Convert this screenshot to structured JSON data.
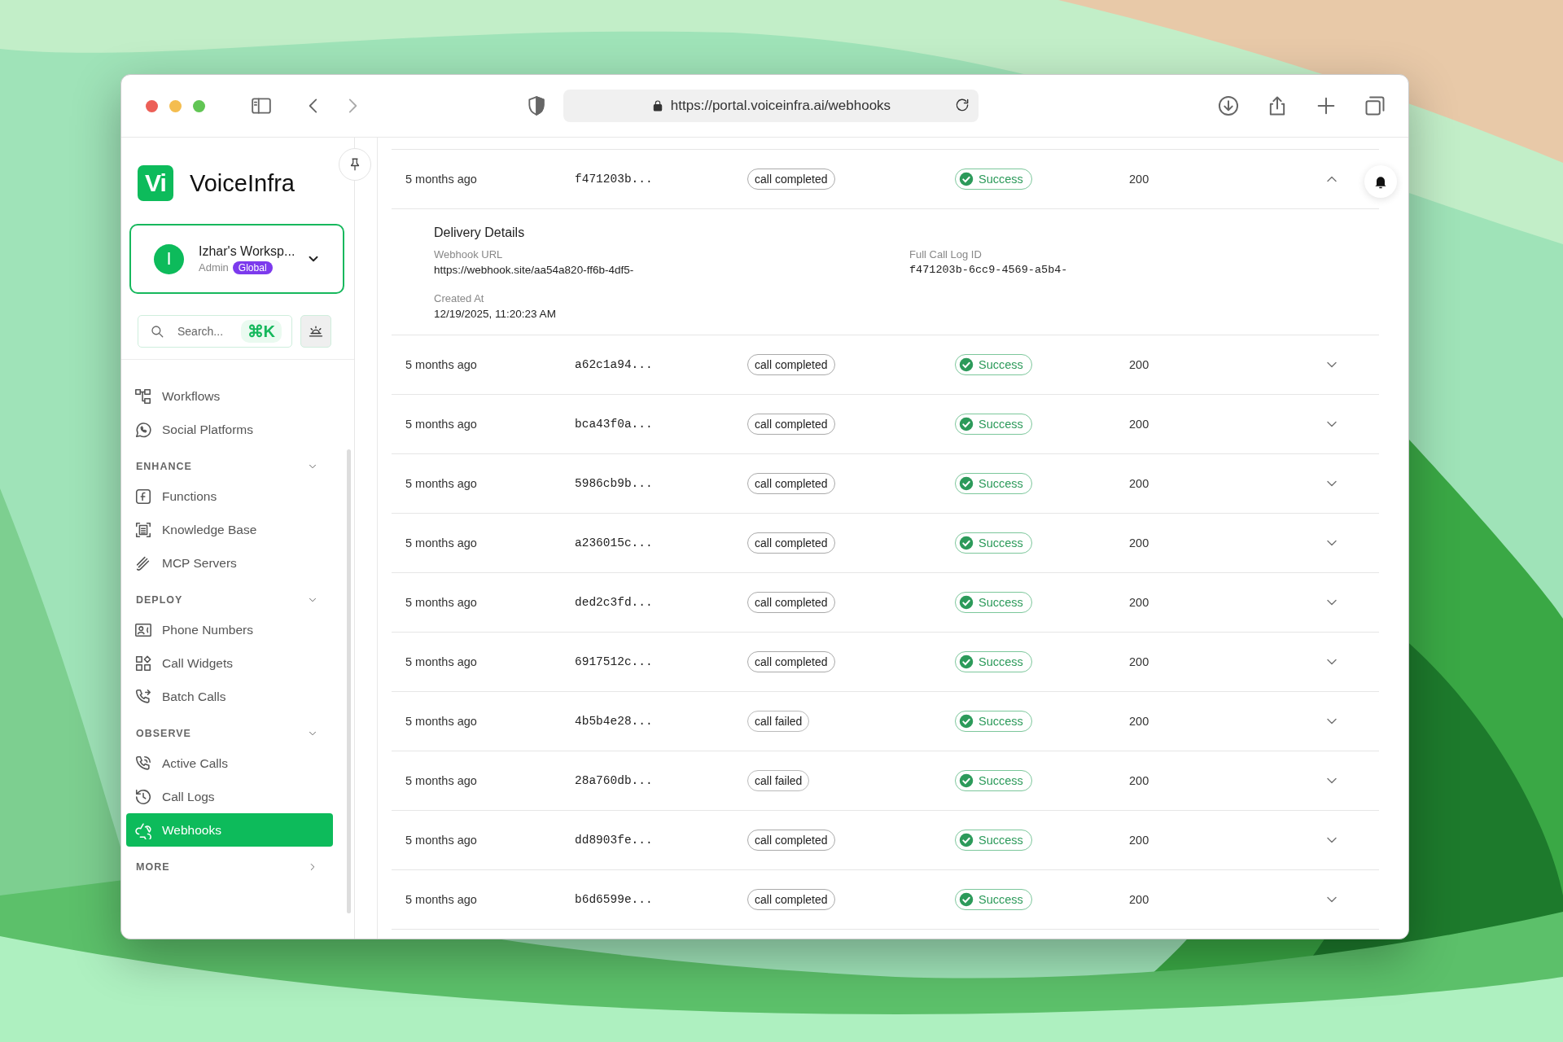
{
  "browser": {
    "url": "https://portal.voiceinfra.ai/webhooks"
  },
  "sidebar": {
    "brand": {
      "mark": "Vi",
      "name": "VoiceInfra"
    },
    "workspace": {
      "initial": "I",
      "name": "Izhar's Worksp...",
      "role": "Admin",
      "badge": "Global"
    },
    "search": {
      "placeholder": "Search...",
      "shortcut": "⌘K"
    },
    "sections": [
      {
        "items": [
          {
            "label": "Workflows",
            "selected": false
          },
          {
            "label": "Social Platforms",
            "selected": false
          }
        ]
      },
      {
        "title": "ENHANCE",
        "expanded": true,
        "items": [
          {
            "label": "Functions",
            "selected": false
          },
          {
            "label": "Knowledge Base",
            "selected": false
          },
          {
            "label": "MCP Servers",
            "selected": false
          }
        ]
      },
      {
        "title": "DEPLOY",
        "expanded": true,
        "items": [
          {
            "label": "Phone Numbers",
            "selected": false
          },
          {
            "label": "Call Widgets",
            "selected": false
          },
          {
            "label": "Batch Calls",
            "selected": false
          }
        ]
      },
      {
        "title": "OBSERVE",
        "expanded": true,
        "items": [
          {
            "label": "Active Calls",
            "selected": false
          },
          {
            "label": "Call Logs",
            "selected": false
          },
          {
            "label": "Webhooks",
            "selected": true
          }
        ]
      },
      {
        "title": "MORE",
        "expanded": false
      }
    ]
  },
  "table": {
    "rows": [
      {
        "time": "5 months ago",
        "id": "f471203b...",
        "event": "call completed",
        "status": "Success",
        "code": "200",
        "expanded": true,
        "details": {
          "title": "Delivery Details",
          "fields": [
            {
              "label": "Webhook URL",
              "value": "https://webhook.site/aa54a820-ff6b-4df5-",
              "kind": "text"
            },
            {
              "label": "Full Call Log ID",
              "value": "f471203b-6cc9-4569-a5b4-",
              "kind": "code"
            },
            {
              "label": "Created At",
              "value": "12/19/2025, 11:20:23 AM",
              "kind": "text"
            }
          ]
        }
      },
      {
        "time": "5 months ago",
        "id": "a62c1a94...",
        "event": "call completed",
        "status": "Success",
        "code": "200",
        "expanded": false
      },
      {
        "time": "5 months ago",
        "id": "bca43f0a...",
        "event": "call completed",
        "status": "Success",
        "code": "200",
        "expanded": false
      },
      {
        "time": "5 months ago",
        "id": "5986cb9b...",
        "event": "call completed",
        "status": "Success",
        "code": "200",
        "expanded": false
      },
      {
        "time": "5 months ago",
        "id": "a236015c...",
        "event": "call completed",
        "status": "Success",
        "code": "200",
        "expanded": false
      },
      {
        "time": "5 months ago",
        "id": "ded2c3fd...",
        "event": "call completed",
        "status": "Success",
        "code": "200",
        "expanded": false
      },
      {
        "time": "5 months ago",
        "id": "6917512c...",
        "event": "call completed",
        "status": "Success",
        "code": "200",
        "expanded": false
      },
      {
        "time": "5 months ago",
        "id": "4b5b4e28...",
        "event": "call failed",
        "status": "Success",
        "code": "200",
        "expanded": false
      },
      {
        "time": "5 months ago",
        "id": "28a760db...",
        "event": "call failed",
        "status": "Success",
        "code": "200",
        "expanded": false
      },
      {
        "time": "5 months ago",
        "id": "dd8903fe...",
        "event": "call completed",
        "status": "Success",
        "code": "200",
        "expanded": false
      },
      {
        "time": "5 months ago",
        "id": "b6d6599e...",
        "event": "call completed",
        "status": "Success",
        "code": "200",
        "expanded": false
      }
    ]
  }
}
